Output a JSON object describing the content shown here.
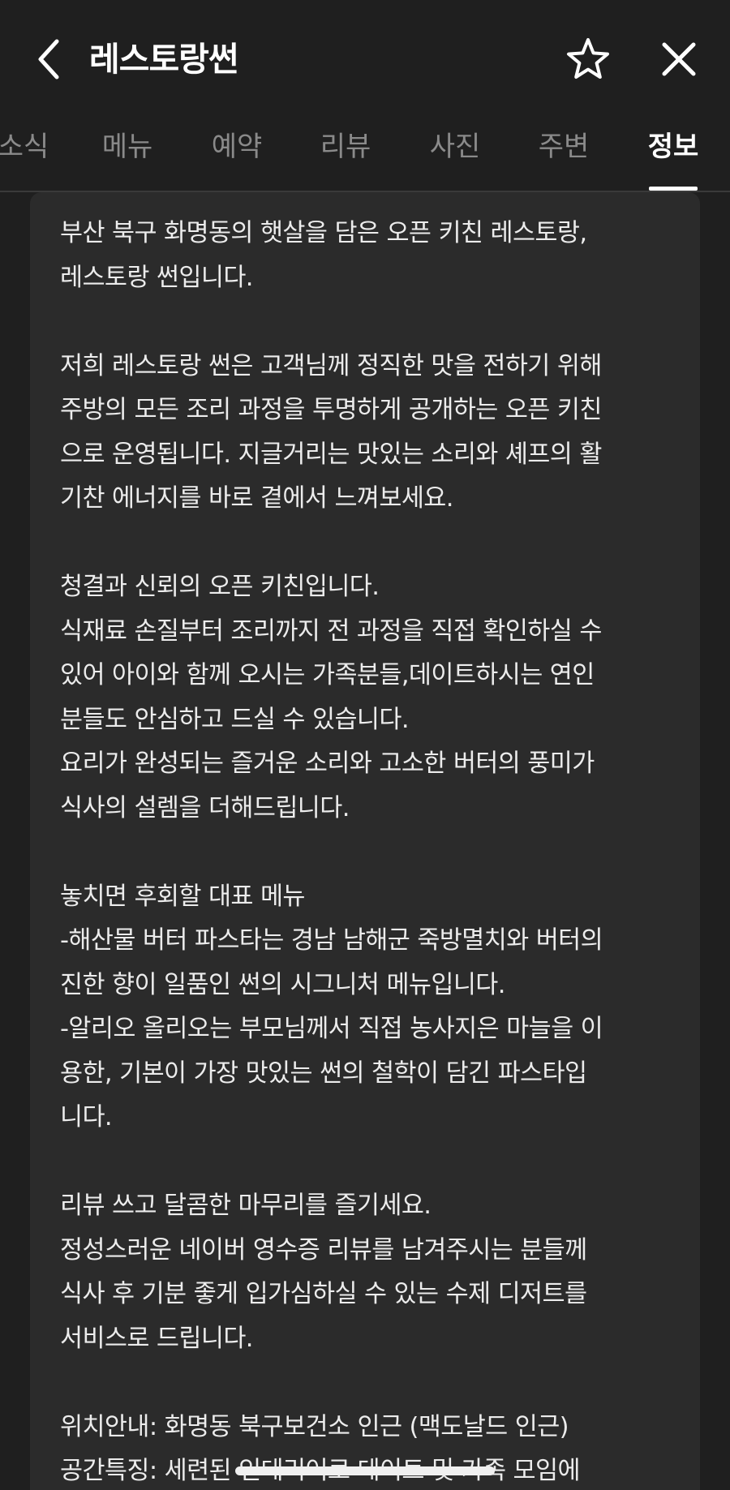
{
  "header": {
    "title": "레스토랑썬",
    "back_icon": "chevron-left-icon",
    "favorite_icon": "star-outline-icon",
    "close_icon": "close-icon"
  },
  "tabs": [
    {
      "label": "소식",
      "active": false
    },
    {
      "label": "메뉴",
      "active": false
    },
    {
      "label": "예약",
      "active": false
    },
    {
      "label": "리뷰",
      "active": false
    },
    {
      "label": "사진",
      "active": false
    },
    {
      "label": "주변",
      "active": false
    },
    {
      "label": "정보",
      "active": true
    }
  ],
  "info": {
    "description": "부산 북구 화명동의 햇살을 담은 오픈 키친 레스토랑,\n레스토랑 썬입니다.\n\n저희 레스토랑 썬은 고객님께 정직한 맛을 전하기 위해\n주방의 모든 조리 과정을 투명하게 공개하는 오픈 키친\n으로 운영됩니다. 지글거리는 맛있는 소리와 셰프의 활\n기찬 에너지를 바로 곁에서 느껴보세요.\n\n청결과 신뢰의 오픈 키친입니다.\n식재료 손질부터 조리까지 전 과정을 직접 확인하실 수\n있어 아이와 함께 오시는 가족분들,데이트하시는 연인\n분들도 안심하고 드실 수 있습니다.\n요리가 완성되는 즐거운 소리와 고소한 버터의 풍미가\n식사의 설렘을 더해드립니다.\n\n놓치면 후회할 대표 메뉴\n-해산물 버터 파스타는 경남 남해군 죽방멸치와 버터의\n진한 향이 일품인 썬의 시그니처 메뉴입니다.\n-알리오 올리오는 부모님께서 직접 농사지은 마늘을 이\n용한, 기본이 가장 맛있는 썬의 철학이 담긴 파스타입\n니다.\n\n리뷰 쓰고 달콤한 마무리를 즐기세요.\n정성스러운 네이버 영수증 리뷰를 남겨주시는 분들께\n식사 후 기분 좋게 입가심하실 수 있는 수제 디저트를\n서비스로 드립니다.\n\n위치안내: 화명동 북구보건소 인근 (맥도날드 인근)\n공간특징: 세련된 인테리어로 데이트 및 가족 모임에"
  },
  "colors": {
    "background": "#1f1f1f",
    "card": "#2b2b2b",
    "text": "#ececec",
    "tab_inactive": "#8a8a8a",
    "tab_active": "#ffffff"
  }
}
